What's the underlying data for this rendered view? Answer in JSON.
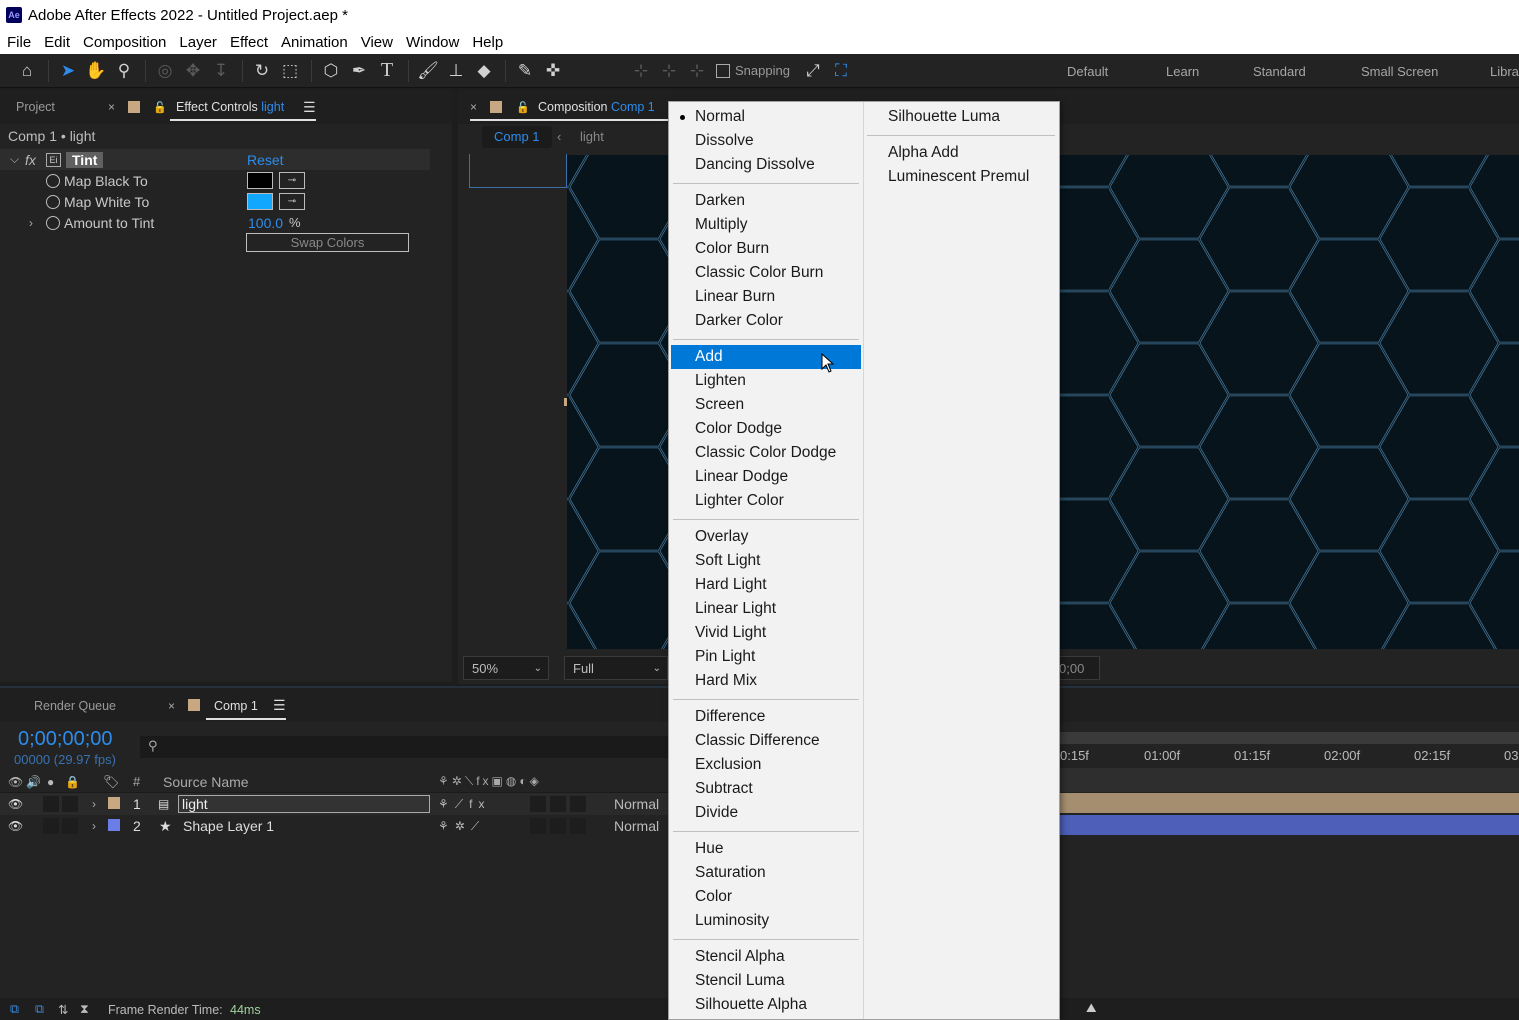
{
  "window": {
    "title": "Adobe After Effects 2022 - Untitled Project.aep *",
    "logo_text": "Ae"
  },
  "menubar": [
    "File",
    "Edit",
    "Composition",
    "Layer",
    "Effect",
    "Animation",
    "View",
    "Window",
    "Help"
  ],
  "toolbar": {
    "snapping_label": "Snapping",
    "workspaces": [
      "Default",
      "Learn",
      "Standard",
      "Small Screen",
      "Libra"
    ]
  },
  "project_panel": {
    "project_tab": "Project",
    "effect_controls_tab": "Effect Controls",
    "effect_controls_layer": "light",
    "header": "Comp 1 • light",
    "effect_name": "Tint",
    "reset_label": "Reset",
    "params": [
      {
        "label": "Map Black To"
      },
      {
        "label": "Map White To"
      },
      {
        "label": "Amount to Tint",
        "value": "100.0",
        "unit": "%"
      }
    ],
    "swap_label": "Swap Colors",
    "colors": {
      "black": "#000000",
      "white_map": "#11a7ff"
    }
  },
  "composition_panel": {
    "tab_label": "Composition",
    "tab_name": "Comp 1",
    "breadcrumbs": [
      "Comp 1",
      "light"
    ],
    "zoom": "50%",
    "resolution": "Full",
    "timecode": "0;00"
  },
  "timeline": {
    "render_queue_tab": "Render Queue",
    "comp_tab": "Comp 1",
    "current_time": "0;00;00;00",
    "frame_info": "00000 (29.97 fps)",
    "column_source_name": "Source Name",
    "column_hash": "#",
    "layers": [
      {
        "index": "1",
        "name": "light",
        "mode": "Normal",
        "color": "#c8a882"
      },
      {
        "index": "2",
        "name": "Shape Layer 1",
        "mode": "Normal",
        "color": "#6b7ee6"
      }
    ],
    "ruler": [
      "0:15f",
      "01:00f",
      "01:15f",
      "02:00f",
      "02:15f",
      "03"
    ],
    "frame_render_label": "Frame Render Time:",
    "frame_render_value": "44ms"
  },
  "blend_menu": {
    "column1": [
      {
        "label": "Normal",
        "checked": true
      },
      {
        "label": "Dissolve"
      },
      {
        "label": "Dancing Dissolve"
      },
      {
        "label": "Darken"
      },
      {
        "label": "Multiply"
      },
      {
        "label": "Color Burn"
      },
      {
        "label": "Classic Color Burn"
      },
      {
        "label": "Linear Burn"
      },
      {
        "label": "Darker Color"
      },
      {
        "label": "Add",
        "highlighted": true
      },
      {
        "label": "Lighten"
      },
      {
        "label": "Screen"
      },
      {
        "label": "Color Dodge"
      },
      {
        "label": "Classic Color Dodge"
      },
      {
        "label": "Linear Dodge"
      },
      {
        "label": "Lighter Color"
      },
      {
        "label": "Overlay"
      },
      {
        "label": "Soft Light"
      },
      {
        "label": "Hard Light"
      },
      {
        "label": "Linear Light"
      },
      {
        "label": "Vivid Light"
      },
      {
        "label": "Pin Light"
      },
      {
        "label": "Hard Mix"
      },
      {
        "label": "Difference"
      },
      {
        "label": "Classic Difference"
      },
      {
        "label": "Exclusion"
      },
      {
        "label": "Subtract"
      },
      {
        "label": "Divide"
      },
      {
        "label": "Hue"
      },
      {
        "label": "Saturation"
      },
      {
        "label": "Color"
      },
      {
        "label": "Luminosity"
      },
      {
        "label": "Stencil Alpha"
      },
      {
        "label": "Stencil Luma"
      },
      {
        "label": "Silhouette Alpha"
      }
    ],
    "column2": [
      {
        "label": "Silhouette Luma"
      },
      {
        "label": "Alpha Add"
      },
      {
        "label": "Luminescent Premul"
      }
    ],
    "highlight_color": "#0078d7"
  }
}
